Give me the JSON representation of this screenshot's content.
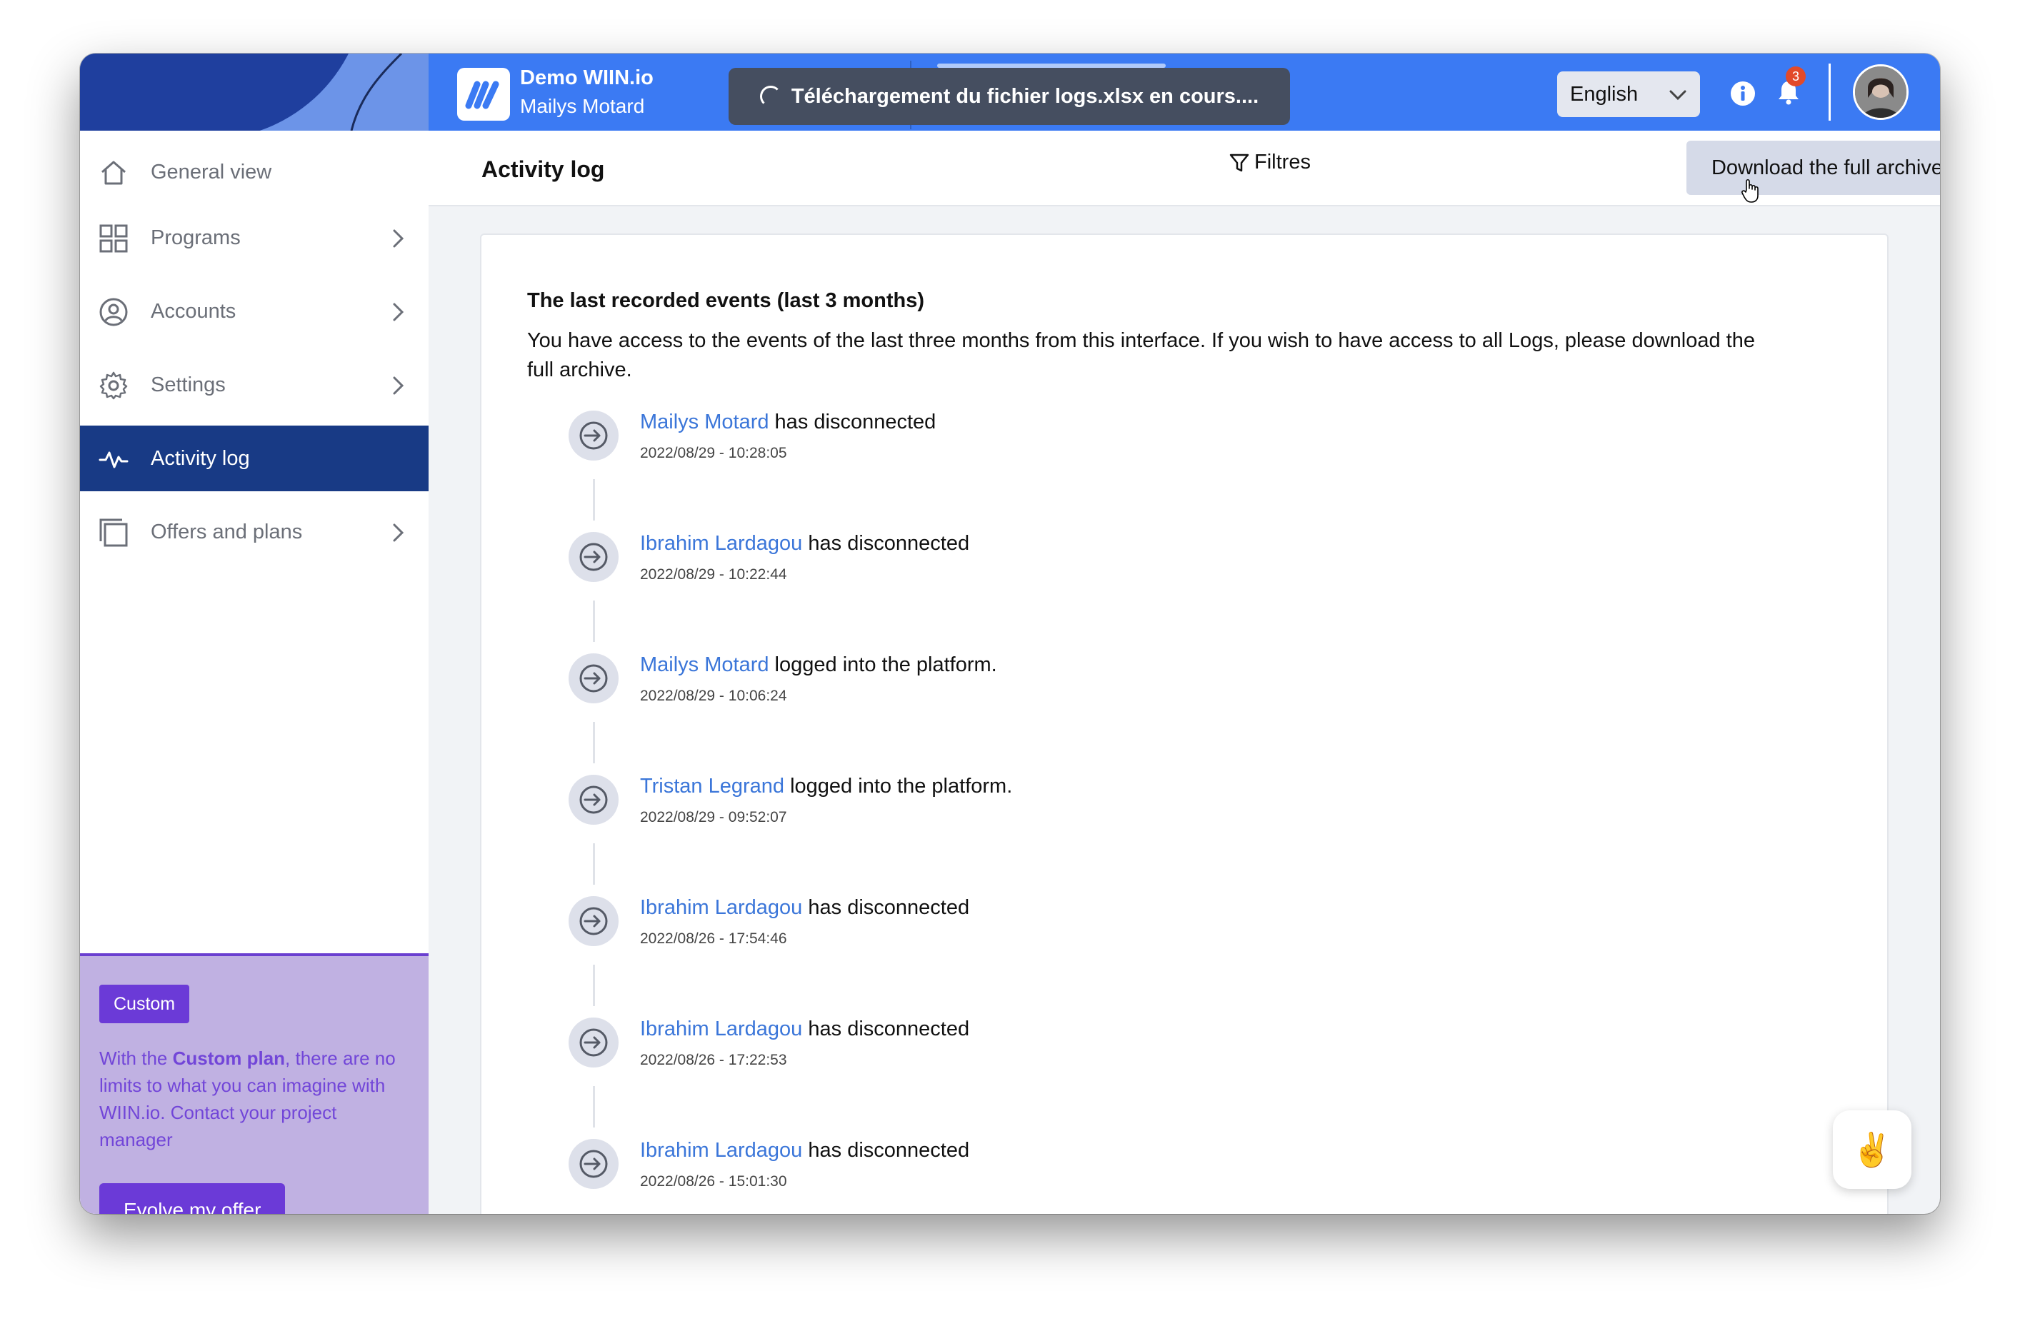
{
  "app": {
    "title": "Demo WIIN.io",
    "user": "Mailys Motard"
  },
  "toast": {
    "message": "Téléchargement du fichier logs.xlsx en cours...."
  },
  "header": {
    "language": "English",
    "notification_count": "3"
  },
  "sidebar": {
    "items": [
      {
        "label": "General view",
        "icon": "home-icon",
        "has_arrow": false
      },
      {
        "label": "Programs",
        "icon": "grid-icon",
        "has_arrow": true
      },
      {
        "label": "Accounts",
        "icon": "user-circle-icon",
        "has_arrow": true
      },
      {
        "label": "Settings",
        "icon": "gear-icon",
        "has_arrow": true
      },
      {
        "label": "Activity log",
        "icon": "activity-icon",
        "has_arrow": false,
        "active": true
      },
      {
        "label": "Offers and plans",
        "icon": "copy-icon",
        "has_arrow": true
      }
    ],
    "promo": {
      "badge": "Custom",
      "text_prefix": "With the ",
      "text_bold": "Custom plan",
      "text_suffix": ", there are no limits to what you can imagine with WIIN.io. Contact your project manager",
      "button": "Evolve my offer"
    }
  },
  "main": {
    "title": "Activity log",
    "filter_label": "Filtres",
    "download_label": "Download the full archive",
    "card_title": "The last recorded events (last 3 months)",
    "card_description": "You have access to the events of the last three months from this interface. If you wish to have access to all Logs, please download the full archive.",
    "events": [
      {
        "user": "Mailys Motard",
        "action": " has disconnected",
        "time": "2022/08/29 - 10:28:05"
      },
      {
        "user": "Ibrahim Lardagou",
        "action": " has disconnected",
        "time": "2022/08/29 - 10:22:44"
      },
      {
        "user": "Mailys Motard",
        "action": " logged into the platform.",
        "time": "2022/08/29 - 10:06:24"
      },
      {
        "user": "Tristan Legrand",
        "action": " logged into the platform.",
        "time": "2022/08/29 - 09:52:07"
      },
      {
        "user": "Ibrahim Lardagou",
        "action": " has disconnected",
        "time": "2022/08/26 - 17:54:46"
      },
      {
        "user": "Ibrahim Lardagou",
        "action": " has disconnected",
        "time": "2022/08/26 - 17:22:53"
      },
      {
        "user": "Ibrahim Lardagou",
        "action": " has disconnected",
        "time": "2022/08/26 - 15:01:30"
      }
    ]
  },
  "floating": {
    "emoji": "✌️"
  },
  "colors": {
    "topbar": "#3b7af3",
    "sidebar_active": "#183a85",
    "promo_bg": "#c0b1e2",
    "promo_accent": "#6b3ad7",
    "link": "#3b76d9"
  }
}
